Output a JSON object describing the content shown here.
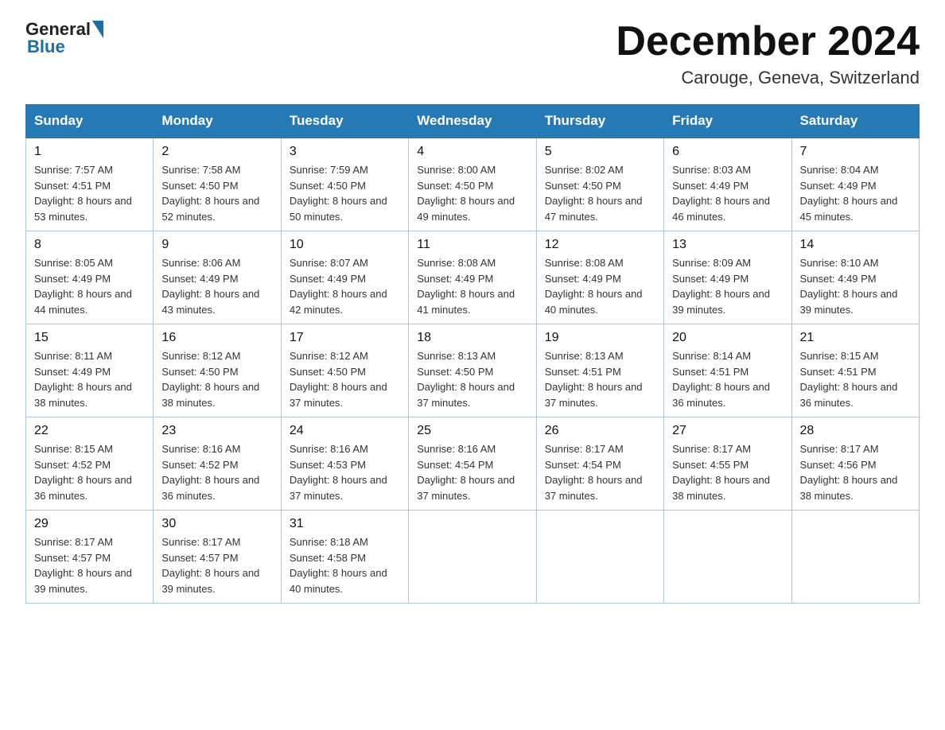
{
  "header": {
    "logo_general": "General",
    "logo_blue": "Blue",
    "month_title": "December 2024",
    "location": "Carouge, Geneva, Switzerland"
  },
  "days_of_week": [
    "Sunday",
    "Monday",
    "Tuesday",
    "Wednesday",
    "Thursday",
    "Friday",
    "Saturday"
  ],
  "weeks": [
    [
      {
        "day": "1",
        "sunrise": "7:57 AM",
        "sunset": "4:51 PM",
        "daylight": "8 hours and 53 minutes."
      },
      {
        "day": "2",
        "sunrise": "7:58 AM",
        "sunset": "4:50 PM",
        "daylight": "8 hours and 52 minutes."
      },
      {
        "day": "3",
        "sunrise": "7:59 AM",
        "sunset": "4:50 PM",
        "daylight": "8 hours and 50 minutes."
      },
      {
        "day": "4",
        "sunrise": "8:00 AM",
        "sunset": "4:50 PM",
        "daylight": "8 hours and 49 minutes."
      },
      {
        "day": "5",
        "sunrise": "8:02 AM",
        "sunset": "4:50 PM",
        "daylight": "8 hours and 47 minutes."
      },
      {
        "day": "6",
        "sunrise": "8:03 AM",
        "sunset": "4:49 PM",
        "daylight": "8 hours and 46 minutes."
      },
      {
        "day": "7",
        "sunrise": "8:04 AM",
        "sunset": "4:49 PM",
        "daylight": "8 hours and 45 minutes."
      }
    ],
    [
      {
        "day": "8",
        "sunrise": "8:05 AM",
        "sunset": "4:49 PM",
        "daylight": "8 hours and 44 minutes."
      },
      {
        "day": "9",
        "sunrise": "8:06 AM",
        "sunset": "4:49 PM",
        "daylight": "8 hours and 43 minutes."
      },
      {
        "day": "10",
        "sunrise": "8:07 AM",
        "sunset": "4:49 PM",
        "daylight": "8 hours and 42 minutes."
      },
      {
        "day": "11",
        "sunrise": "8:08 AM",
        "sunset": "4:49 PM",
        "daylight": "8 hours and 41 minutes."
      },
      {
        "day": "12",
        "sunrise": "8:08 AM",
        "sunset": "4:49 PM",
        "daylight": "8 hours and 40 minutes."
      },
      {
        "day": "13",
        "sunrise": "8:09 AM",
        "sunset": "4:49 PM",
        "daylight": "8 hours and 39 minutes."
      },
      {
        "day": "14",
        "sunrise": "8:10 AM",
        "sunset": "4:49 PM",
        "daylight": "8 hours and 39 minutes."
      }
    ],
    [
      {
        "day": "15",
        "sunrise": "8:11 AM",
        "sunset": "4:49 PM",
        "daylight": "8 hours and 38 minutes."
      },
      {
        "day": "16",
        "sunrise": "8:12 AM",
        "sunset": "4:50 PM",
        "daylight": "8 hours and 38 minutes."
      },
      {
        "day": "17",
        "sunrise": "8:12 AM",
        "sunset": "4:50 PM",
        "daylight": "8 hours and 37 minutes."
      },
      {
        "day": "18",
        "sunrise": "8:13 AM",
        "sunset": "4:50 PM",
        "daylight": "8 hours and 37 minutes."
      },
      {
        "day": "19",
        "sunrise": "8:13 AM",
        "sunset": "4:51 PM",
        "daylight": "8 hours and 37 minutes."
      },
      {
        "day": "20",
        "sunrise": "8:14 AM",
        "sunset": "4:51 PM",
        "daylight": "8 hours and 36 minutes."
      },
      {
        "day": "21",
        "sunrise": "8:15 AM",
        "sunset": "4:51 PM",
        "daylight": "8 hours and 36 minutes."
      }
    ],
    [
      {
        "day": "22",
        "sunrise": "8:15 AM",
        "sunset": "4:52 PM",
        "daylight": "8 hours and 36 minutes."
      },
      {
        "day": "23",
        "sunrise": "8:16 AM",
        "sunset": "4:52 PM",
        "daylight": "8 hours and 36 minutes."
      },
      {
        "day": "24",
        "sunrise": "8:16 AM",
        "sunset": "4:53 PM",
        "daylight": "8 hours and 37 minutes."
      },
      {
        "day": "25",
        "sunrise": "8:16 AM",
        "sunset": "4:54 PM",
        "daylight": "8 hours and 37 minutes."
      },
      {
        "day": "26",
        "sunrise": "8:17 AM",
        "sunset": "4:54 PM",
        "daylight": "8 hours and 37 minutes."
      },
      {
        "day": "27",
        "sunrise": "8:17 AM",
        "sunset": "4:55 PM",
        "daylight": "8 hours and 38 minutes."
      },
      {
        "day": "28",
        "sunrise": "8:17 AM",
        "sunset": "4:56 PM",
        "daylight": "8 hours and 38 minutes."
      }
    ],
    [
      {
        "day": "29",
        "sunrise": "8:17 AM",
        "sunset": "4:57 PM",
        "daylight": "8 hours and 39 minutes."
      },
      {
        "day": "30",
        "sunrise": "8:17 AM",
        "sunset": "4:57 PM",
        "daylight": "8 hours and 39 minutes."
      },
      {
        "day": "31",
        "sunrise": "8:18 AM",
        "sunset": "4:58 PM",
        "daylight": "8 hours and 40 minutes."
      },
      null,
      null,
      null,
      null
    ]
  ]
}
